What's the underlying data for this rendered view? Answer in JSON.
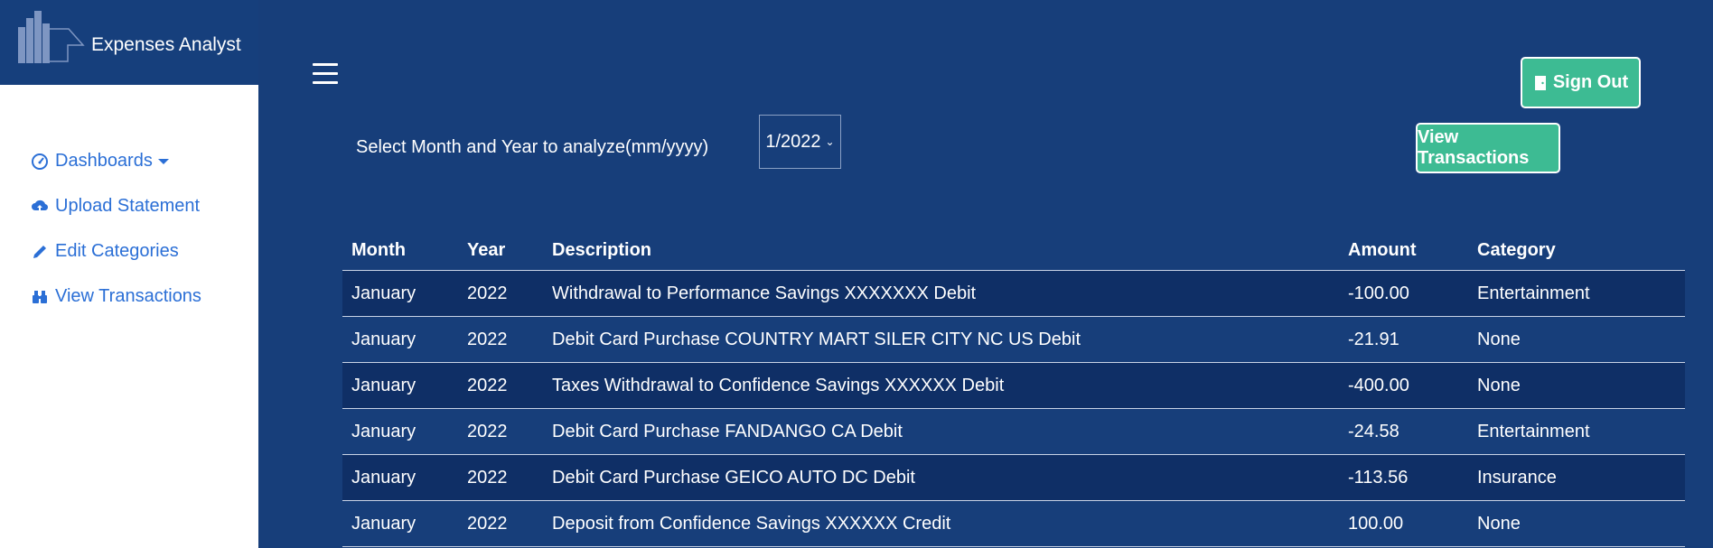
{
  "brand": {
    "app_name": "Expenses Analyst"
  },
  "sidebar": {
    "items": [
      {
        "label": "Dashboards",
        "icon": "gauge-icon"
      },
      {
        "label": "Upload Statement",
        "icon": "cloud-upload-icon"
      },
      {
        "label": "Edit Categories",
        "icon": "pencil-icon"
      },
      {
        "label": "View Transactions",
        "icon": "binoculars-icon"
      }
    ]
  },
  "header": {
    "sign_out_label": "Sign Out"
  },
  "filter": {
    "label": "Select Month and Year to analyze(mm/yyyy)",
    "selected": "1/2022",
    "view_button_label": "View Transactions"
  },
  "table": {
    "headers": [
      "Month",
      "Year",
      "Description",
      "Amount",
      "Category"
    ],
    "rows": [
      {
        "month": "January",
        "year": "2022",
        "description": "Withdrawal to Performance Savings XXXXXXX Debit",
        "amount": "-100.00",
        "category": "Entertainment"
      },
      {
        "month": "January",
        "year": "2022",
        "description": "Debit Card Purchase COUNTRY MART SILER CITY NC US Debit",
        "amount": "-21.91",
        "category": "None"
      },
      {
        "month": "January",
        "year": "2022",
        "description": "Taxes Withdrawal to Confidence Savings XXXXXX Debit",
        "amount": "-400.00",
        "category": "None"
      },
      {
        "month": "January",
        "year": "2022",
        "description": "Debit Card Purchase FANDANGO CA Debit",
        "amount": "-24.58",
        "category": "Entertainment"
      },
      {
        "month": "January",
        "year": "2022",
        "description": "Debit Card Purchase GEICO AUTO DC Debit",
        "amount": "-113.56",
        "category": "Insurance"
      },
      {
        "month": "January",
        "year": "2022",
        "description": "Deposit from Confidence Savings XXXXXX Credit",
        "amount": "100.00",
        "category": "None"
      }
    ]
  },
  "colors": {
    "background": "#173e7a",
    "accent": "#3dbb93",
    "link": "#2b6fd6"
  }
}
